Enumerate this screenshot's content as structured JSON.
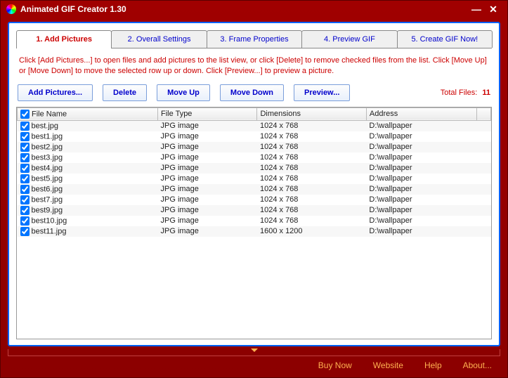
{
  "title": "Animated GIF Creator 1.30",
  "tabs": [
    {
      "label": "1. Add Pictures",
      "active": true
    },
    {
      "label": "2. Overall Settings",
      "active": false
    },
    {
      "label": "3. Frame Properties",
      "active": false
    },
    {
      "label": "4. Preview GIF",
      "active": false
    },
    {
      "label": "5. Create GIF Now!",
      "active": false
    }
  ],
  "instructions": "Click [Add Pictures...] to open files and add pictures to the list view, or click [Delete] to remove checked files from the list. Click [Move Up] or [Move Down] to move the selected row up or down. Click [Preview...] to preview a picture.",
  "buttons": {
    "add": "Add Pictures...",
    "delete": "Delete",
    "moveup": "Move Up",
    "movedown": "Move Down",
    "preview": "Preview..."
  },
  "total_label": "Total Files:",
  "total_count": "11",
  "columns": [
    "File Name",
    "File Type",
    "Dimensions",
    "Address"
  ],
  "rows": [
    {
      "name": "best.jpg",
      "type": "JPG image",
      "dim": "1024 x 768",
      "addr": "D:\\wallpaper"
    },
    {
      "name": "best1.jpg",
      "type": "JPG image",
      "dim": "1024 x 768",
      "addr": "D:\\wallpaper"
    },
    {
      "name": "best2.jpg",
      "type": "JPG image",
      "dim": "1024 x 768",
      "addr": "D:\\wallpaper"
    },
    {
      "name": "best3.jpg",
      "type": "JPG image",
      "dim": "1024 x 768",
      "addr": "D:\\wallpaper"
    },
    {
      "name": "best4.jpg",
      "type": "JPG image",
      "dim": "1024 x 768",
      "addr": "D:\\wallpaper"
    },
    {
      "name": "best5.jpg",
      "type": "JPG image",
      "dim": "1024 x 768",
      "addr": "D:\\wallpaper"
    },
    {
      "name": "best6.jpg",
      "type": "JPG image",
      "dim": "1024 x 768",
      "addr": "D:\\wallpaper"
    },
    {
      "name": "best7.jpg",
      "type": "JPG image",
      "dim": "1024 x 768",
      "addr": "D:\\wallpaper"
    },
    {
      "name": "best9.jpg",
      "type": "JPG image",
      "dim": "1024 x 768",
      "addr": "D:\\wallpaper"
    },
    {
      "name": "best10.jpg",
      "type": "JPG image",
      "dim": "1024 x 768",
      "addr": "D:\\wallpaper"
    },
    {
      "name": "best11.jpg",
      "type": "JPG image",
      "dim": "1600 x 1200",
      "addr": "D:\\wallpaper"
    }
  ],
  "footer": {
    "buynow": "Buy Now",
    "website": "Website",
    "help": "Help",
    "about": "About..."
  }
}
